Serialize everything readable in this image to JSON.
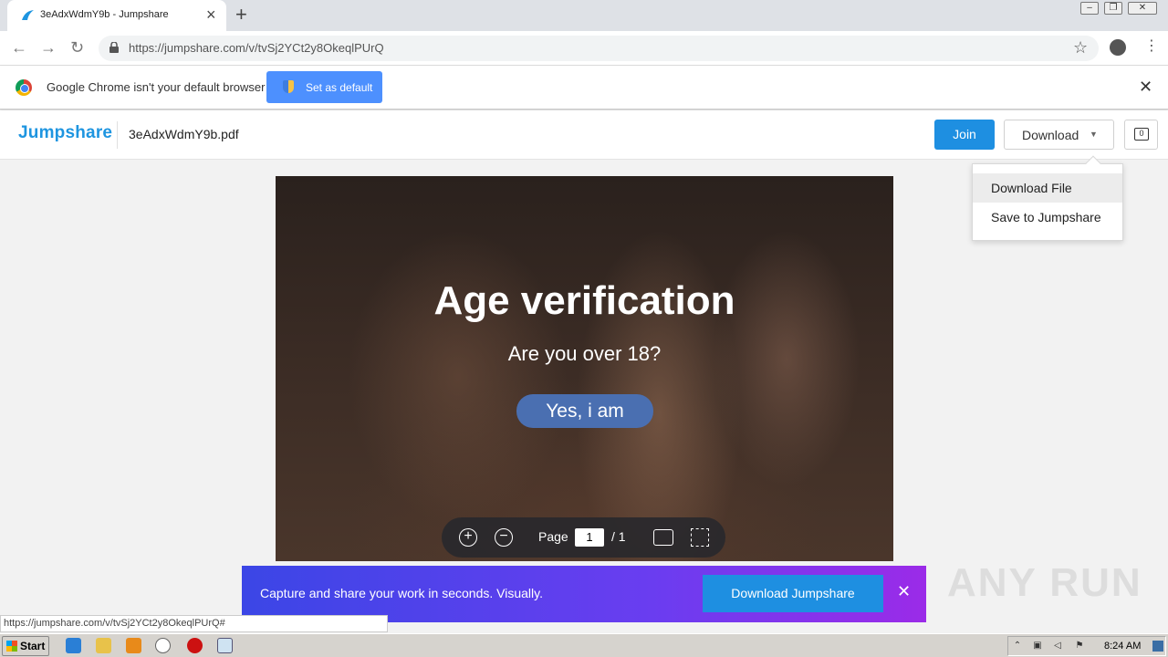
{
  "browser": {
    "tab_title": "3eAdxWdmY9b - Jumpshare",
    "url": "https://jumpshare.com/v/tvSj2YCt2y8OkeqlPUrQ"
  },
  "infobar": {
    "message": "Google Chrome isn't your default browser",
    "button_label": "Set as default"
  },
  "jumpshare": {
    "logo": "Jumpshare",
    "filename": "3eAdxWdmY9b.pdf",
    "join_label": "Join",
    "download_label": "Download",
    "comment_count": "0",
    "dropdown": [
      "Download File",
      "Save to Jumpshare"
    ]
  },
  "document": {
    "title": "Age verification",
    "subtitle": "Are you over 18?",
    "button": "Yes, i am"
  },
  "viewer": {
    "page_label": "Page",
    "page_current": "1",
    "page_total": "/ 1"
  },
  "promo": {
    "text": "Capture and share your work in seconds. Visually.",
    "button": "Download Jumpshare"
  },
  "status_url": "https://jumpshare.com/v/tvSj2YCt2y8OkeqlPUrQ#",
  "watermark": "ANY RUN",
  "taskbar": {
    "start_label": "Start",
    "clock": "8:24 AM"
  },
  "colors": {
    "accent": "#1e8fe1",
    "chrome_infobar_button": "#4d90fe",
    "verify_button": "#4a6fb1"
  }
}
